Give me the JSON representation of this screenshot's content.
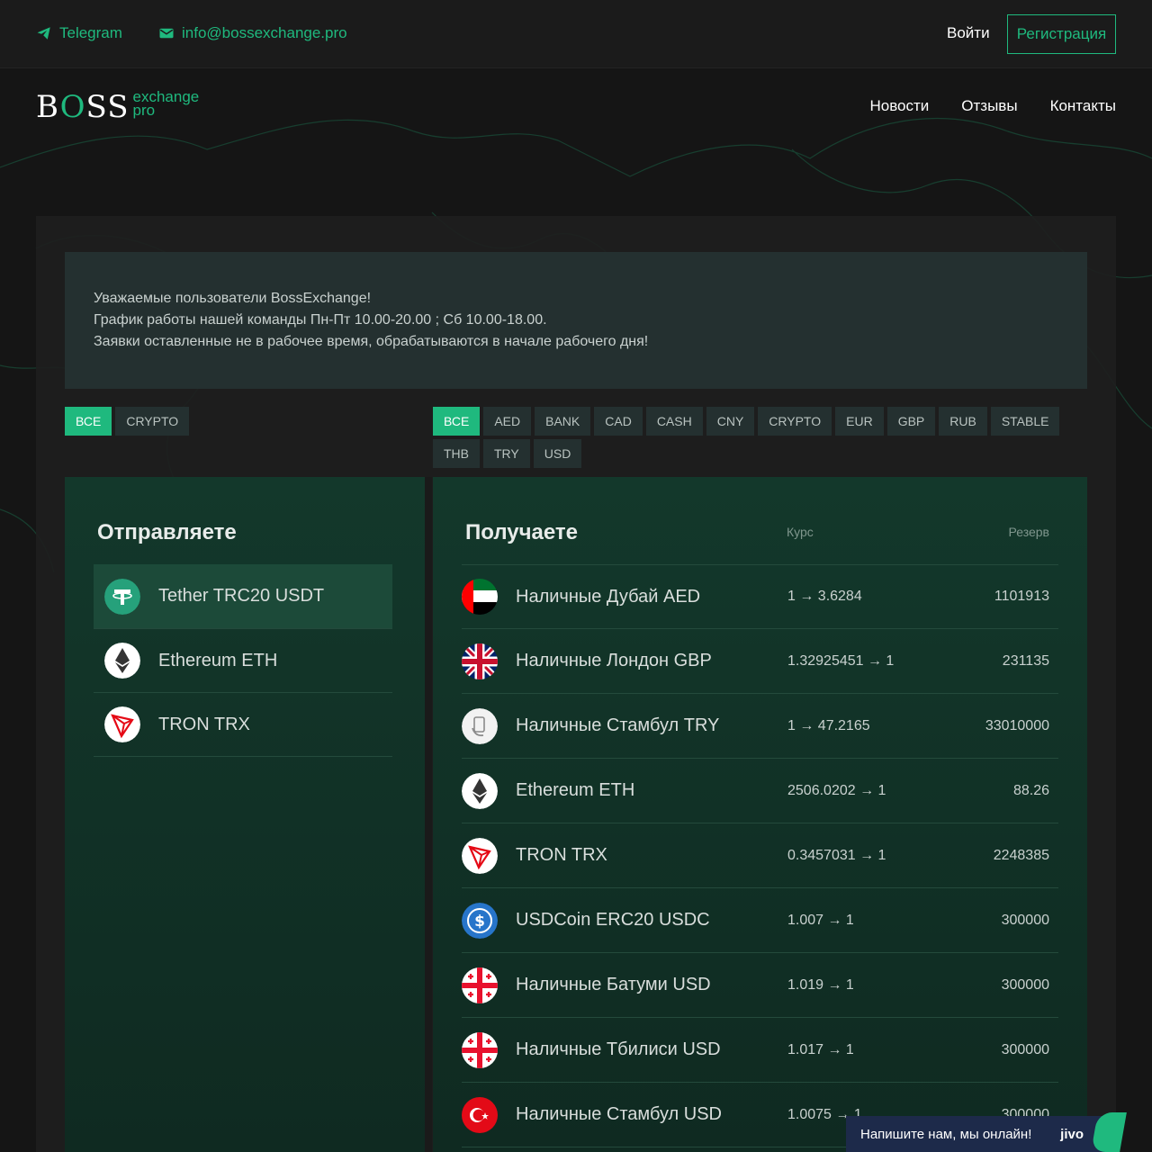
{
  "topbar": {
    "telegram_label": "Telegram",
    "email_label": "info@bossexchange.pro",
    "login_label": "Войти",
    "register_label": "Регистрация"
  },
  "logo": {
    "brand_prefix": "B",
    "brand_o": "O",
    "brand_suffix": "SS",
    "sub1": "exchange",
    "sub2": "pro"
  },
  "nav": {
    "items": [
      "Новости",
      "Отзывы",
      "Контакты"
    ]
  },
  "notice": {
    "lines": [
      "Уважаемые пользователи BossExchange!",
      "График работы нашей команды Пн-Пт 10.00-20.00 ; Сб 10.00-18.00.",
      "Заявки оставленные не в рабочее время, обрабатываются в начале рабочего дня!"
    ]
  },
  "filters_left": [
    "ВСЕ",
    "CRYPTO"
  ],
  "filters_right": [
    "ВСЕ",
    "AED",
    "BANK",
    "CAD",
    "CASH",
    "CNY",
    "CRYPTO",
    "EUR",
    "GBP",
    "RUB",
    "STABLE",
    "THB",
    "TRY",
    "USD"
  ],
  "send": {
    "title": "Отправляете",
    "items": [
      {
        "name": "Tether TRC20 USDT",
        "icon": "tether-icon"
      },
      {
        "name": "Ethereum ETH",
        "icon": "ethereum-icon"
      },
      {
        "name": "TRON TRX",
        "icon": "tron-icon"
      }
    ]
  },
  "receive": {
    "title": "Получаете",
    "rate_header": "Курс",
    "reserve_header": "Резерв",
    "items": [
      {
        "name": "Наличные Дубай AED",
        "rate": "1 → 3.6284",
        "reserve": "1101913",
        "icon": "uae-flag-icon"
      },
      {
        "name": "Наличные Лондон GBP",
        "rate": "1.32925451 → 1",
        "reserve": "231135",
        "icon": "uk-flag-icon"
      },
      {
        "name": "Наличные Стамбул TRY",
        "rate": "1 → 47.2165",
        "reserve": "33010000",
        "icon": "cash-hand-icon"
      },
      {
        "name": "Ethereum ETH",
        "rate": "2506.0202 → 1",
        "reserve": "88.26",
        "icon": "ethereum-icon"
      },
      {
        "name": "TRON TRX",
        "rate": "0.3457031 → 1",
        "reserve": "2248385",
        "icon": "tron-icon"
      },
      {
        "name": "USDCoin ERC20 USDC",
        "rate": "1.007 → 1",
        "reserve": "300000",
        "icon": "usdc-icon"
      },
      {
        "name": "Наличные Батуми USD",
        "rate": "1.019 → 1",
        "reserve": "300000",
        "icon": "georgia-flag-icon"
      },
      {
        "name": "Наличные Тбилиси USD",
        "rate": "1.017 → 1",
        "reserve": "300000",
        "icon": "georgia-flag-icon"
      },
      {
        "name": "Наличные Стамбул USD",
        "rate": "1.0075 → 1",
        "reserve": "300000",
        "icon": "turkey-flag-icon"
      }
    ]
  },
  "chat": {
    "text": "Напишите нам, мы онлайн!",
    "brand": "jivo"
  },
  "colors": {
    "accent": "#1fb97e",
    "background": "#151515",
    "panel": "#13382b"
  }
}
